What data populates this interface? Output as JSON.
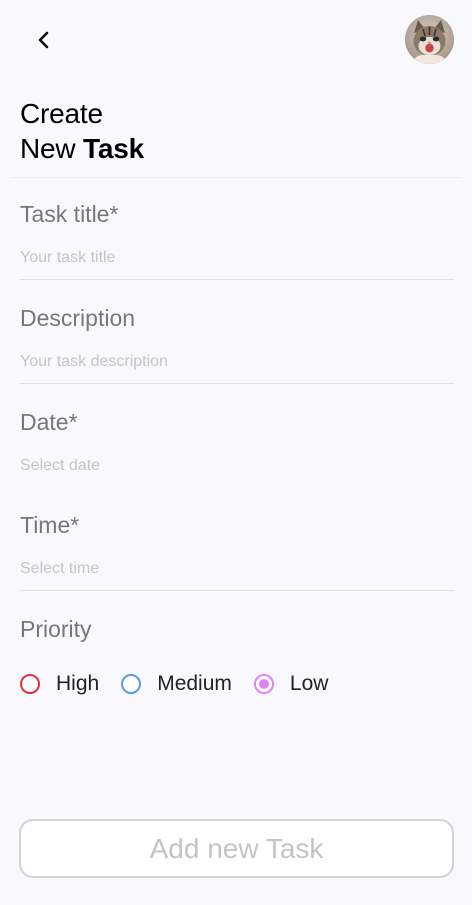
{
  "header": {
    "back_icon": "chevron-left-icon",
    "avatar_icon": "kitten-avatar"
  },
  "title": {
    "line1": "Create",
    "line2_regular": "New",
    "line2_bold": "Task"
  },
  "fields": {
    "task_title": {
      "label": "Task title*",
      "placeholder": "Your task title",
      "value": ""
    },
    "description": {
      "label": "Description",
      "placeholder": "Your task description",
      "value": ""
    },
    "date": {
      "label": "Date*",
      "placeholder": "Select date",
      "value": ""
    },
    "time": {
      "label": "Time*",
      "placeholder": "Select time",
      "value": ""
    }
  },
  "priority": {
    "label": "Priority",
    "selected": "Low",
    "options": [
      {
        "label": "High",
        "color": "#e5303a"
      },
      {
        "label": "Medium",
        "color": "#5a9be0"
      },
      {
        "label": "Low",
        "color": "#e281f5"
      }
    ]
  },
  "submit": {
    "label": "Add new Task"
  }
}
